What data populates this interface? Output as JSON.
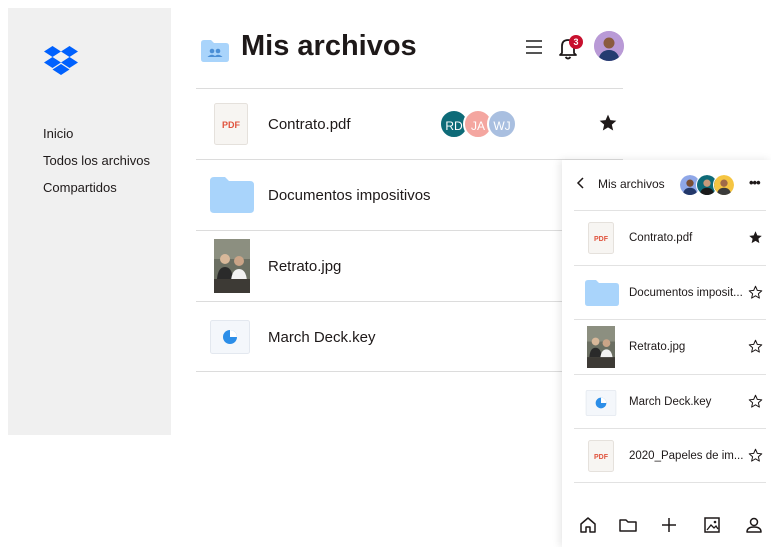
{
  "sidebar": {
    "logo_icon": "dropbox-logo-icon",
    "items": [
      {
        "label": "Inicio"
      },
      {
        "label": "Todos los archivos"
      },
      {
        "label": "Compartidos"
      }
    ]
  },
  "header": {
    "title": "Mis archivos",
    "folder_icon": "shared-folder-icon",
    "menu_icon": "hamburger-icon",
    "bell_icon": "bell-icon",
    "notification_count": "3"
  },
  "files": [
    {
      "name": "Contrato.pdf",
      "type": "pdf",
      "thumb_label": "PDF",
      "starred": true,
      "shared_with": [
        {
          "initials": "RD",
          "color": "#0e6b78"
        },
        {
          "initials": "JA",
          "color": "#f4a6a0"
        },
        {
          "initials": "WJ",
          "color": "#a9bfe0"
        }
      ]
    },
    {
      "name": "Documentos impositivos",
      "type": "folder",
      "starred": false
    },
    {
      "name": "Retrato.jpg",
      "type": "image",
      "starred": false
    },
    {
      "name": "March Deck.key",
      "type": "keynote",
      "starred": false
    }
  ],
  "mobile": {
    "back_icon": "chevron-left-icon",
    "title": "Mis archivos",
    "more_icon": "more-icon",
    "files": [
      {
        "name": "Contrato.pdf",
        "type": "pdf",
        "thumb_label": "PDF",
        "starred": true
      },
      {
        "name": "Documentos imposit...",
        "type": "folder",
        "starred": false
      },
      {
        "name": "Retrato.jpg",
        "type": "image",
        "starred": false
      },
      {
        "name": "March Deck.key",
        "type": "keynote",
        "starred": false
      },
      {
        "name": "2020_Papeles de im...",
        "type": "pdf",
        "thumb_label": "PDF",
        "starred": false
      }
    ],
    "tabs": [
      "home-icon",
      "folder-icon",
      "plus-icon",
      "photos-icon",
      "account-icon"
    ]
  },
  "colors": {
    "sidebar_bg": "#f0f0f0",
    "dropbox_blue": "#0061fe",
    "folder_blue": "#a9d4fb",
    "pdf_red": "#e0533d",
    "badge_red": "#c8102e",
    "keynote_blue": "#2c8ee8"
  }
}
